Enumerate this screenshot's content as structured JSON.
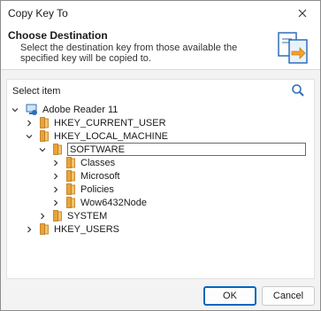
{
  "window": {
    "title": "Copy Key To"
  },
  "header": {
    "title": "Choose Destination",
    "description": "Select the destination key from those available the specified key will be copied to."
  },
  "panel": {
    "select_label": "Select item"
  },
  "tree": {
    "root": "Adobe Reader 11",
    "hkcu": "HKEY_CURRENT_USER",
    "hklm": "HKEY_LOCAL_MACHINE",
    "software": "SOFTWARE",
    "classes": "Classes",
    "microsoft": "Microsoft",
    "policies": "Policies",
    "wow": "Wow6432Node",
    "system": "SYSTEM",
    "hku": "HKEY_USERS"
  },
  "buttons": {
    "ok": "OK",
    "cancel": "Cancel"
  },
  "colors": {
    "accent": "#0067c0",
    "folder": "#e8a33a"
  }
}
